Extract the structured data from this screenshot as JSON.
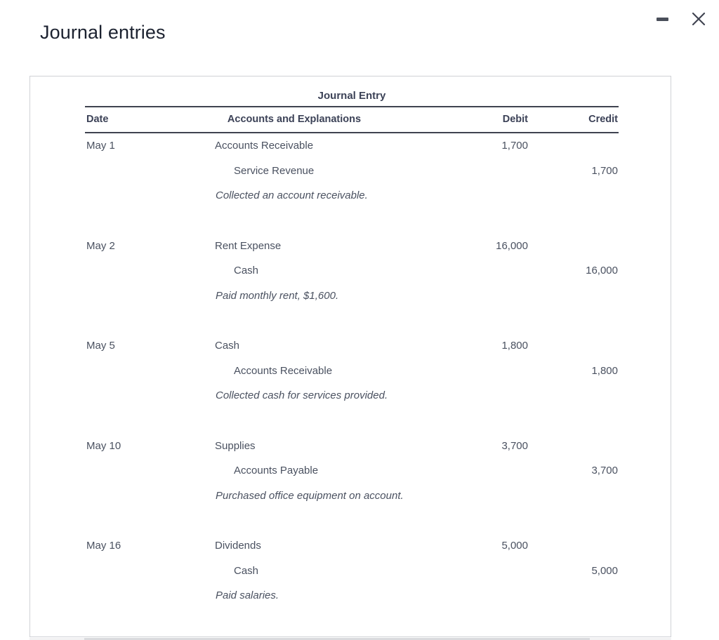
{
  "window": {
    "title": "Journal entries",
    "controls": [
      {
        "name": "minimize",
        "label": "Minimize"
      },
      {
        "name": "close",
        "label": "Close"
      }
    ]
  },
  "card": {
    "table": {
      "caption": "Journal Entry",
      "columns": {
        "date": "Date",
        "account": "Accounts and Explanations",
        "debit": "Debit",
        "credit": "Credit"
      },
      "entries": [
        {
          "date": "May 1",
          "debit_account": "Accounts Receivable",
          "debit_amount": "1,700",
          "credit_account": "Service Revenue",
          "credit_amount": "1,700",
          "explanation": "Collected an account receivable."
        },
        {
          "date": "May 2",
          "debit_account": "Rent Expense",
          "debit_amount": "16,000",
          "credit_account": "Cash",
          "credit_amount": "16,000",
          "explanation": "Paid monthly rent, $1,600."
        },
        {
          "date": "May 5",
          "debit_account": "Cash",
          "debit_amount": "1,800",
          "credit_account": "Accounts Receivable",
          "credit_amount": "1,800",
          "explanation": "Collected cash for services provided."
        },
        {
          "date": "May 10",
          "debit_account": "Supplies",
          "debit_amount": "3,700",
          "credit_account": "Accounts Payable",
          "credit_amount": "3,700",
          "explanation": "Purchased office equipment on account."
        },
        {
          "date": "May 16",
          "debit_account": "Dividends",
          "debit_amount": "5,000",
          "credit_account": "Cash",
          "credit_amount": "5,000",
          "explanation": "Paid salaries."
        }
      ]
    }
  },
  "colors": {
    "text": "#4a5160",
    "heading": "#3c4257",
    "title": "#1c2230",
    "rule": "#3f4350",
    "card_border": "#d0d2d6",
    "background": "#ffffff"
  }
}
